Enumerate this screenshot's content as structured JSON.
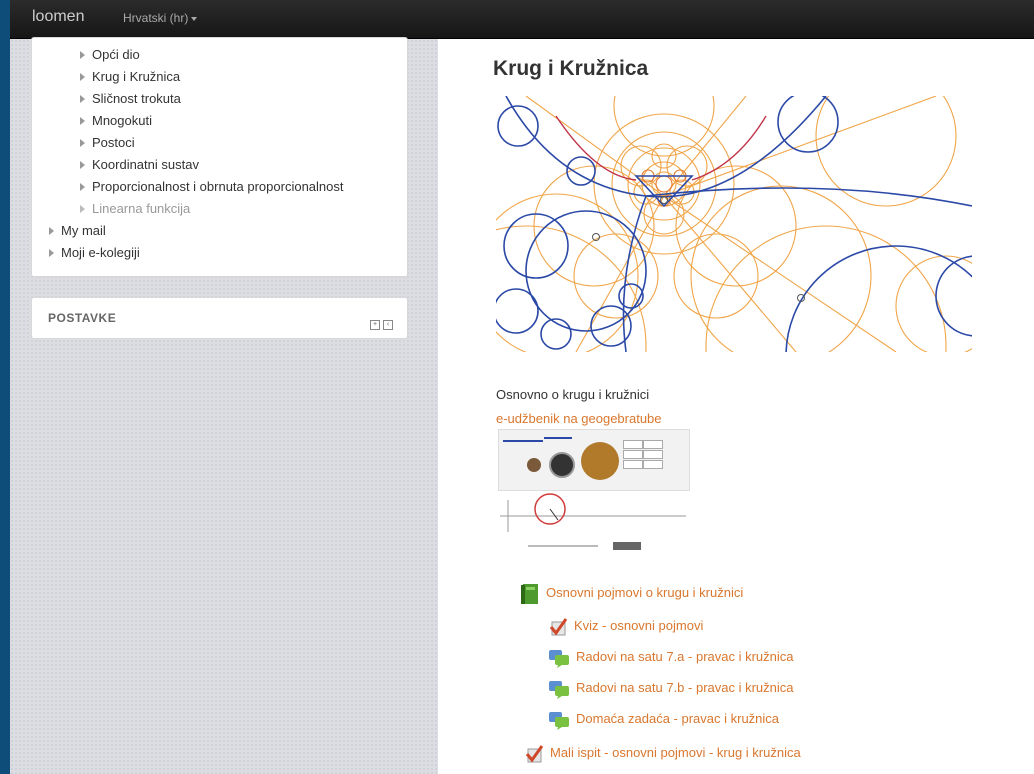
{
  "navbar": {
    "brand": "loomen",
    "language": "Hrvatski (hr)"
  },
  "navigation": {
    "course_items": [
      {
        "label": "Opći dio",
        "dimmed": false
      },
      {
        "label": "Krug i Kružnica",
        "dimmed": false
      },
      {
        "label": "Sličnost trokuta",
        "dimmed": false
      },
      {
        "label": "Mnogokuti",
        "dimmed": false
      },
      {
        "label": "Postoci",
        "dimmed": false
      },
      {
        "label": "Koordinatni sustav",
        "dimmed": false
      },
      {
        "label": "Proporcionalnost i obrnuta proporcionalnost",
        "dimmed": false
      },
      {
        "label": "Linearna funkcija",
        "dimmed": true
      }
    ],
    "top_items": [
      {
        "label": "My mail"
      },
      {
        "label": "Moji e-kolegiji"
      }
    ]
  },
  "settings_block": {
    "title": "POSTAVKE"
  },
  "main": {
    "title": "Krug i Kružnica",
    "intro": "Osnovno o krugu i kružnici",
    "ebook_link": "e-udžbenik na geogebratube",
    "book": {
      "label": "Osnovni pojmovi o krugu i kružnici",
      "icon": "book-icon"
    },
    "sub_activities": [
      {
        "label": "Kviz - osnovni pojmovi",
        "icon": "quiz-icon"
      },
      {
        "label": "Radovi na satu 7.a - pravac i kružnica",
        "icon": "forum-icon"
      },
      {
        "label": "Radovi na satu 7.b - pravac i kružnica",
        "icon": "forum-icon"
      },
      {
        "label": "Domaća zadaća - pravac i kružnica",
        "icon": "forum-icon"
      }
    ],
    "final_activity": {
      "label": "Mali ispit - osnovni pojmovi - krug i kružnica",
      "icon": "quiz-icon"
    }
  },
  "colors": {
    "link": "#d9772e",
    "navbar": "#1c1c1c",
    "page_frame": "#0e4d7a"
  }
}
